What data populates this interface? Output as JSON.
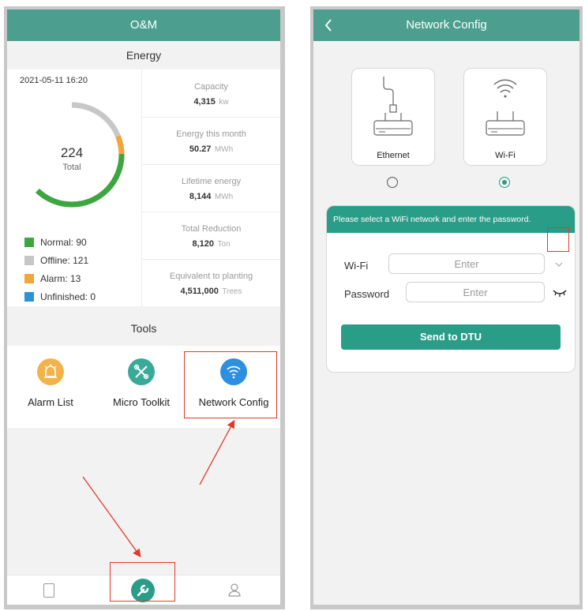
{
  "left": {
    "header_title": "O&M",
    "energy_title": "Energy",
    "timestamp": "2021-05-11 16:20",
    "ring": {
      "total_value": "224",
      "total_label": "Total"
    },
    "legend": [
      {
        "label": "Normal: 90",
        "color": "#3ea641"
      },
      {
        "label": "Offline: 121",
        "color": "#c7c7c7"
      },
      {
        "label": "Alarm: 13",
        "color": "#f3a43a"
      },
      {
        "label": "Unfinished: 0",
        "color": "#2a93d8"
      }
    ],
    "stats": [
      {
        "label": "Capacity",
        "value": "4,315",
        "unit": "kw"
      },
      {
        "label": "Energy this month",
        "value": "50.27",
        "unit": "MWh"
      },
      {
        "label": "Lifetime energy",
        "value": "8,144",
        "unit": "MWh"
      },
      {
        "label": "Total Reduction",
        "value": "8,120",
        "unit": "Ton"
      },
      {
        "label": "Equivalent to planting",
        "value": "4,511,000",
        "unit": "Trees"
      }
    ],
    "tools_title": "Tools",
    "tools": [
      {
        "label": "Alarm List",
        "icon": "alarm-icon",
        "color": "#f2b34a"
      },
      {
        "label": "Micro Toolkit",
        "icon": "toolkit-icon",
        "color": "#3aaa98"
      },
      {
        "label": "Network Config",
        "icon": "wifi-icon",
        "color": "#2e8fe0"
      }
    ],
    "bottom_nav": [
      "report-icon",
      "wrench-icon",
      "user-icon"
    ]
  },
  "right": {
    "header_title": "Network Config",
    "back_icon": "chevron-left-icon",
    "options": [
      {
        "label": "Ethernet",
        "selected": false
      },
      {
        "label": "Wi-Fi",
        "selected": true
      }
    ],
    "notice": "Please select a WiFi network and enter the password.",
    "wifi_label": "Wi-Fi",
    "wifi_placeholder": "Enter",
    "password_label": "Password",
    "password_placeholder": "Enter",
    "send_label": "Send to DTU",
    "colors": {
      "primary": "#2a9d89",
      "header": "#4c9f8f"
    }
  }
}
